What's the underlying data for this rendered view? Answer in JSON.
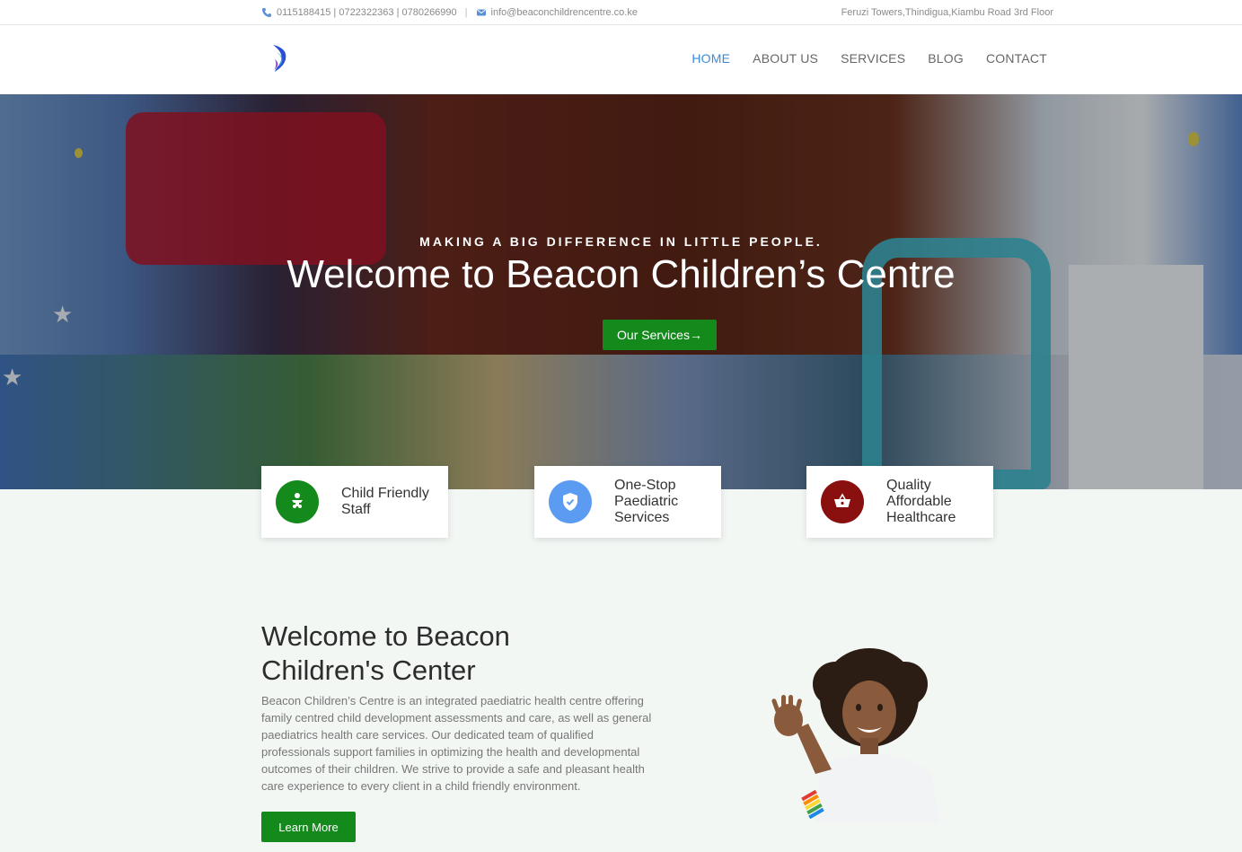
{
  "topbar": {
    "phones": "0115188415 | 0722322363 | 0780266990",
    "email": "info@beaconchildrencentre.co.ke",
    "address": "Feruzi Towers,Thindigua,Kiambu Road 3rd Floor",
    "phone_icon": "phone-icon",
    "email_icon": "mail-icon"
  },
  "nav": {
    "items": [
      {
        "label": "HOME",
        "active": true
      },
      {
        "label": "ABOUT US",
        "active": false
      },
      {
        "label": "SERVICES",
        "active": false
      },
      {
        "label": "BLOG",
        "active": false
      },
      {
        "label": "CONTACT",
        "active": false
      }
    ]
  },
  "hero": {
    "tagline": "MAKING A BIG DIFFERENCE IN LITTLE PEOPLE.",
    "title": "Welcome to Beacon Children’s Centre",
    "button": "Our Services→"
  },
  "features": [
    {
      "label": "Child Friendly Staff",
      "icon": "baby-icon",
      "color": "#138a1b"
    },
    {
      "label": "One-Stop Paediatric Services",
      "icon": "shield-check-icon",
      "color": "#5b9cf2"
    },
    {
      "label": "Quality Affordable Healthcare",
      "icon": "basket-icon",
      "color": "#8a0f0f"
    }
  ],
  "about": {
    "title": "Welcome to Beacon Children's Center",
    "text": "Beacon Children’s Centre is an integrated paediatric health centre offering family centred child development assessments and care, as well as general paediatrics health care services. Our dedicated team of qualified professionals support families in optimizing the health and developmental outcomes of their children. We strive to provide a safe and pleasant health care experience to every client in a child friendly environment.",
    "button": "Learn More"
  },
  "colors": {
    "accent_green": "#138a1b",
    "nav_active": "#3b8ad9",
    "background": "#f3f7f4"
  }
}
